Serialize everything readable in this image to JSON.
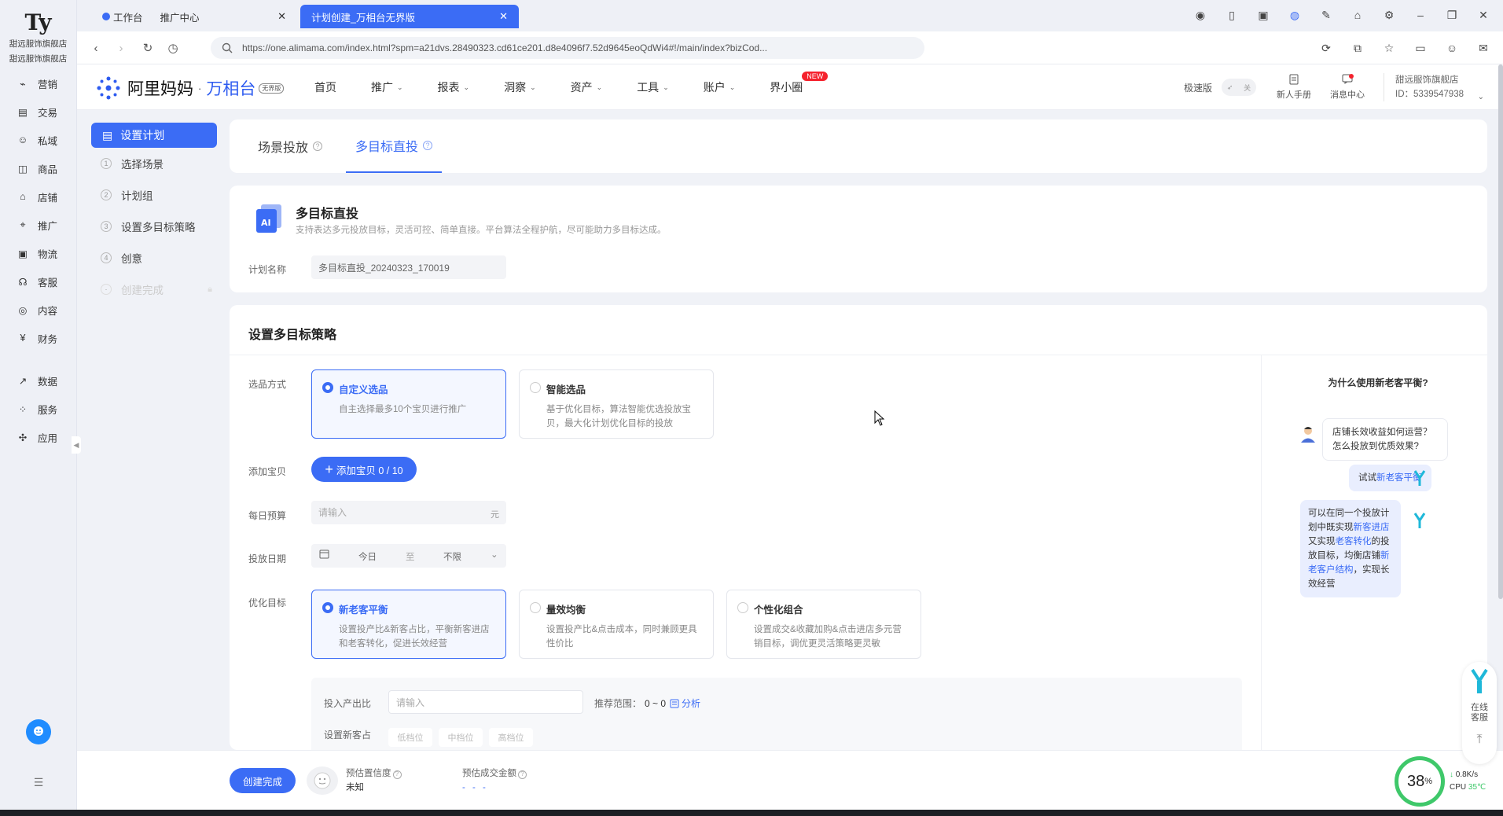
{
  "rail": {
    "logo_letter": "Ty",
    "shop_line1": "甜远服饰旗舰店",
    "shop_line2": "甜远服饰旗舰店",
    "items": [
      {
        "label": "营销",
        "icon": "megaphone-icon"
      },
      {
        "label": "交易",
        "icon": "document-icon"
      },
      {
        "label": "私域",
        "icon": "users-icon"
      },
      {
        "label": "商品",
        "icon": "bag-icon"
      },
      {
        "label": "店铺",
        "icon": "store-icon"
      },
      {
        "label": "推广",
        "icon": "location-icon"
      },
      {
        "label": "物流",
        "icon": "box-icon"
      },
      {
        "label": "客服",
        "icon": "headset-icon"
      },
      {
        "label": "内容",
        "icon": "content-icon"
      },
      {
        "label": "财务",
        "icon": "finance-icon"
      }
    ],
    "items2": [
      {
        "label": "数据",
        "icon": "chart-icon"
      },
      {
        "label": "服务",
        "icon": "grid-icon"
      },
      {
        "label": "应用",
        "icon": "apps-icon"
      }
    ]
  },
  "browser": {
    "tab1_a": "工作台",
    "tab1_b": "推广中心",
    "tab2": "计划创建_万相台无界版",
    "url": "https://one.alimama.com/index.html?spm=a21dvs.28490323.cd61ce201.d8e4096f7.52d9645eoQdWi4#!/main/index?bizCod..."
  },
  "header": {
    "brand_cn": "阿里妈妈",
    "brand_sep": "·",
    "brand_product": "万相台",
    "brand_badge": "无界版",
    "nav": [
      {
        "label": "首页",
        "dropdown": false
      },
      {
        "label": "推广",
        "dropdown": true
      },
      {
        "label": "报表",
        "dropdown": true
      },
      {
        "label": "洞察",
        "dropdown": true
      },
      {
        "label": "资产",
        "dropdown": true
      },
      {
        "label": "工具",
        "dropdown": true
      },
      {
        "label": "账户",
        "dropdown": true
      },
      {
        "label": "界小圈",
        "dropdown": false
      }
    ],
    "new_badge": "NEW",
    "speed_label": "极速版",
    "toggle_text": "关",
    "manual": "新人手册",
    "messages": "消息中心",
    "account_name": "甜远服饰旗舰店",
    "account_id": "ID：5339547938"
  },
  "steps": {
    "active": "设置计划",
    "items": [
      {
        "num": "1",
        "label": "选择场景"
      },
      {
        "num": "2",
        "label": "计划组"
      },
      {
        "num": "3",
        "label": "设置多目标策略"
      },
      {
        "num": "4",
        "label": "创意"
      }
    ],
    "done": "创建完成"
  },
  "tabs": {
    "t1": "场景投放",
    "t2": "多目标直投"
  },
  "info": {
    "title": "多目标直投",
    "subtitle": "支持表达多元投放目标，灵活可控、简单直接。平台算法全程护航，尽可能助力多目标达成。",
    "plan_label": "计划名称",
    "plan_value": "多目标直投_20240323_170019"
  },
  "strategy": {
    "title": "设置多目标策略",
    "select_label": "选品方式",
    "opt_custom_title": "自定义选品",
    "opt_custom_desc": "自主选择最多10个宝贝进行推广",
    "opt_smart_title": "智能选品",
    "opt_smart_desc": "基于优化目标，算法智能优选投放宝贝，最大化计划优化目标的投放",
    "add_label": "添加宝贝",
    "add_btn": "添加宝贝 0 / 10",
    "budget_label": "每日预算",
    "budget_placeholder": "请输入",
    "budget_unit": "元",
    "date_label": "投放日期",
    "date_start": "今日",
    "date_to": "至",
    "date_end": "不限",
    "goal_label": "优化目标",
    "goal1_title": "新老客平衡",
    "goal1_desc": "设置投产比&新客占比，平衡新客进店和老客转化，促进长效经营",
    "goal2_title": "量效均衡",
    "goal2_desc": "设置投产比&点击成本，同时兼顾更具性价比",
    "goal3_title": "个性化组合",
    "goal3_desc": "设置成交&收藏加购&点击进店多元营销目标，调优更灵活策略更灵敏",
    "roi_label": "投入产出比",
    "roi_placeholder": "请输入",
    "range_label": "推荐范围：",
    "range_value": "0 ~ 0",
    "analyze": "分析",
    "newcust_label": "设置新客占",
    "pills": [
      "低档位",
      "中档位",
      "高档位"
    ]
  },
  "chat": {
    "title": "为什么使用新老客平衡?",
    "q": "店铺长效收益如何运营？怎么投放到优质效果?",
    "me_pre": "试试",
    "me_hl": "新老客平衡",
    "ans_1": "可以在同一个投放计划中既实现",
    "ans_hl1": "新客进店",
    "ans_2": "又实现",
    "ans_hl2": "老客转化",
    "ans_3": "的投放目标，均衡店铺",
    "ans_hl3": "新老客户结构",
    "ans_4": "，实现长效经营"
  },
  "bottom": {
    "create": "创建完成",
    "confidence_label": "预估置信度",
    "confidence_value": "未知",
    "gmv_label": "预估成交金额",
    "gmv_value": "- - -"
  },
  "widgets": {
    "online_service": "在线客服",
    "cpu_percent": "38",
    "cpu_unit": "%",
    "net_speed": "0.8K/s",
    "cpu_label": "CPU",
    "cpu_temp": "35℃"
  },
  "colors": {
    "accent": "#3b6cf5",
    "new_badge": "#f5222d",
    "cpu_ring": "#3fc86a"
  }
}
